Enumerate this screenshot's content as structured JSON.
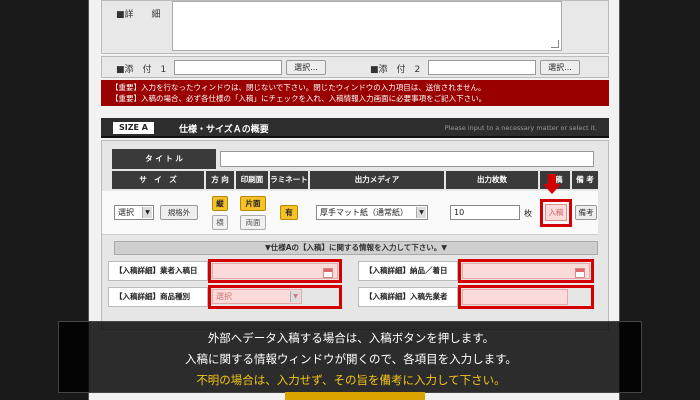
{
  "top_form": {
    "detail_label": "■詳　　細",
    "attach1_label": "■添　付　1",
    "attach2_label": "■添　付　2",
    "browse_label": "選択..."
  },
  "notice": {
    "line1": "【重要】入力を行なったウィンドウは、閉じないで下さい。閉じたウィンドウの入力項目は、送信されません。",
    "line2": "【重要】入稿の場合、必ず各仕様の「入稿」にチェックを入れ、入稿情報入力画面に必要事項をご記入下さい。"
  },
  "size_section": {
    "tag": "SIZE A",
    "title": "仕様・サイズＡの概要",
    "hint": "Please input to a necessary matter or select it."
  },
  "table": {
    "title_label": "タ イ ト ル",
    "headers": {
      "size": "サ　イ　ズ",
      "direction": "方 向",
      "print_side": "印刷面",
      "laminate": "ラミネート",
      "media": "出力メディア",
      "qty": "出力枚数",
      "submit": "入稿",
      "notes": "備 考"
    },
    "size_select": "選択",
    "custom_size_button": "規格外",
    "direction_vertical": "縦",
    "direction_horizontal": "横",
    "single_side": "片面",
    "double_side": "両面",
    "laminate_yes": "有",
    "media_select": "厚手マット紙（通常紙）",
    "qty_value": "10",
    "qty_unit": "枚",
    "submit_button": "入稿",
    "notes_button": "備考"
  },
  "info_bar": "▼仕様Aの【入稿】に関する情報を入力して下さい。▼",
  "details": {
    "vendor_date_label": "【入稿詳細】業者入稿日",
    "delivery_date_label": "【入稿詳細】納品／着日",
    "product_type_label": "【入稿詳細】商品種別",
    "product_type_select": "選択",
    "vendor_name_label": "【入稿詳細】入稿先業者"
  },
  "caption": {
    "line1": "外部へデータ入稿する場合は、入稿ボタンを押します。",
    "line2": "入稿に関する情報ウィンドウが開くので、各項目を入力します。",
    "line3": "不明の場合は、入力せず、その旨を備考に入力して下さい。"
  }
}
